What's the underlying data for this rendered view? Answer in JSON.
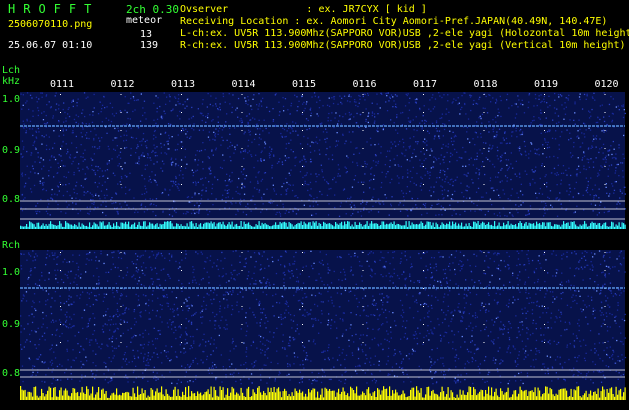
{
  "header": {
    "title": "HROFFT",
    "mode": "2ch 0.30",
    "file": "2506070110.png",
    "meteor_label": "meteor",
    "count_l": "13",
    "count_r": "139",
    "datetime": "25.06.07 01:10"
  },
  "info": {
    "observer": "Ovserver             : ex. JR7CYX [ kid ]",
    "location": "Receiving Location : ex. Aomori City Aomori-Pref.JAPAN(40.49N, 140.47E)",
    "lch": "L-ch:ex. UV5R 113.900Mhz(SAPPORO VOR)USB ,2-ele yagi (Holozontal 10m height)",
    "rch": "R-ch:ex. UV5R 113.900Mhz(SAPPORO VOR)USB ,2-ele yagi (Vertical 10m height)"
  },
  "panels": {
    "lch": {
      "label": "Lch",
      "unit": "kHz",
      "y_ticks": [
        "1.0",
        "0.9",
        "0.8"
      ]
    },
    "rch": {
      "label": "Rch",
      "y_ticks": [
        "1.0",
        "0.9",
        "0.8"
      ]
    }
  },
  "time_ticks": [
    "0111",
    "0112",
    "0113",
    "0114",
    "0115",
    "0116",
    "0117",
    "0118",
    "0119",
    "0120"
  ],
  "colors": {
    "background": "#000000",
    "text_green": "#33ff33",
    "grid": "#ffffff",
    "signal_cyan": "#33ffff",
    "signal_yellow": "#ffff00",
    "noise_blue": "#1a2a8c"
  }
}
